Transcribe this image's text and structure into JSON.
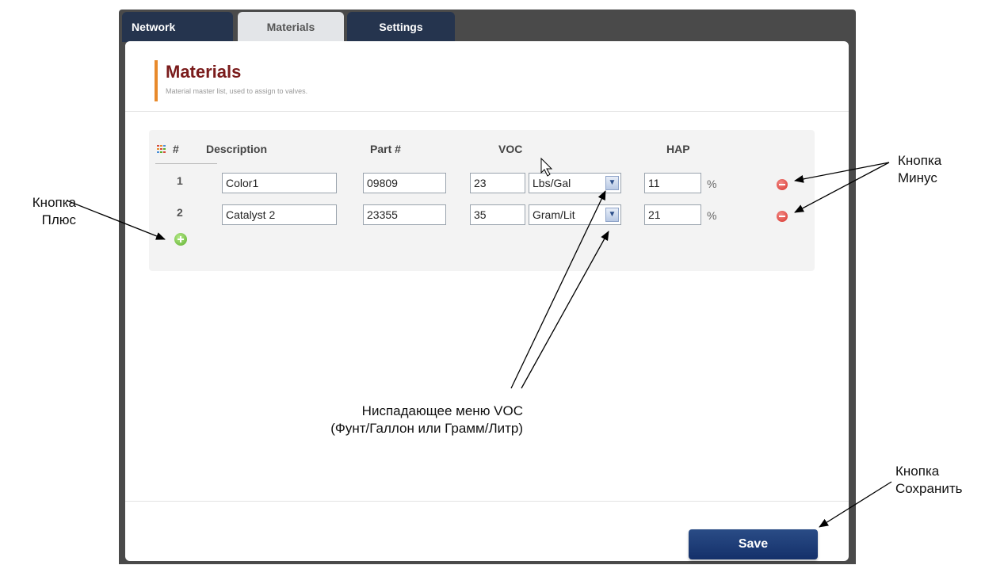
{
  "tabs": [
    {
      "label": "Network"
    },
    {
      "label": "Materials"
    },
    {
      "label": "Settings"
    }
  ],
  "page": {
    "title": "Materials",
    "subtitle": "Material master list, used to assign to valves."
  },
  "table": {
    "columns": [
      "#",
      "Description",
      "Part #",
      "VOC",
      "HAP"
    ],
    "rows": [
      {
        "num": "1",
        "description": "Color1",
        "part": "09809",
        "voc": "23",
        "voc_unit": "Lbs/Gal",
        "hap": "11",
        "hap_unit": "%"
      },
      {
        "num": "2",
        "description": "Catalyst 2",
        "part": "23355",
        "voc": "35",
        "voc_unit": "Gram/Lit",
        "hap": "21",
        "hap_unit": "%"
      }
    ]
  },
  "save_label": "Save",
  "annotations": {
    "plus": [
      "Кнопка",
      "Плюс"
    ],
    "minus": [
      "Кнопка",
      "Минус"
    ],
    "voc_line1": "Ниспадающее меню VOC",
    "voc_line2": "(Фунт/Галлон или Грамм/Литр)",
    "save": [
      "Кнопка",
      "Сохранить"
    ]
  },
  "colors": {
    "tab_active": "#e3e5e8",
    "tab_inactive": "#25344e",
    "title": "#7a1b1b",
    "accent_bar": "#e88a2b",
    "save_button": "#1f3f78",
    "minus_icon": "#d8332c",
    "plus_icon": "#5cae2c"
  },
  "icons": [
    "grid-icon",
    "minus-icon",
    "plus-icon",
    "chevron-down-icon",
    "cursor-icon"
  ]
}
